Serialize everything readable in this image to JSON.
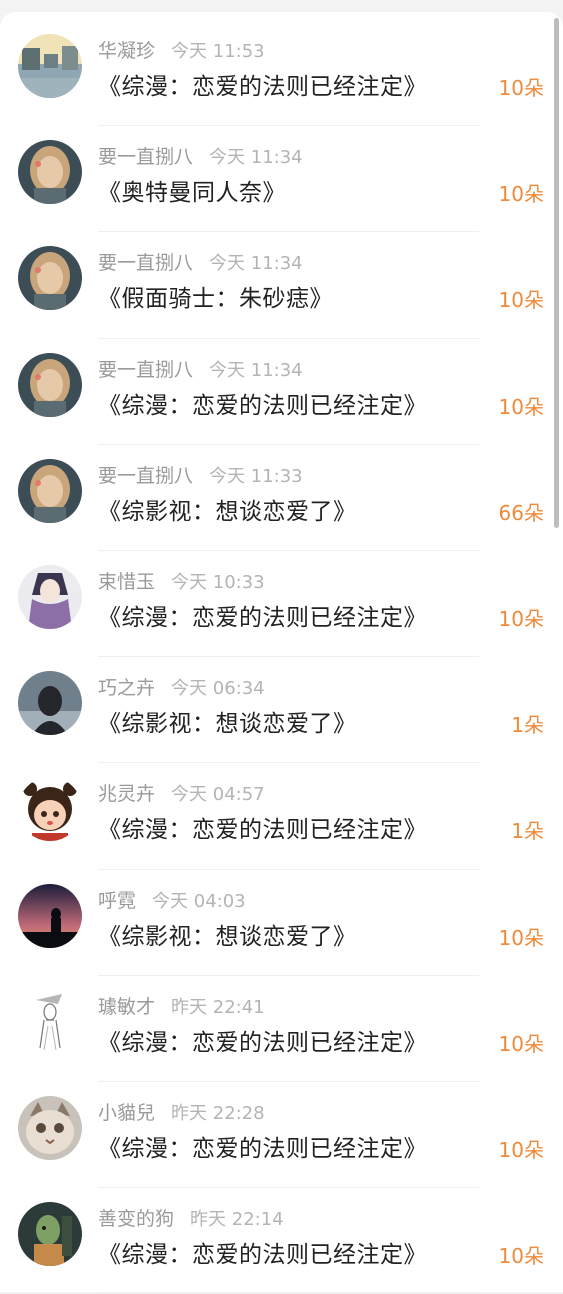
{
  "rows": [
    {
      "user": "华凝珍",
      "time": "今天 11:53",
      "book": "《综漫：恋爱的法则已经注定》",
      "amount": "10朵",
      "avatar": "town-canal-avatar-icon",
      "colors": [
        "#f1e3b8",
        "#8fa7b5",
        "#5e6f72"
      ]
    },
    {
      "user": "要一直捌八",
      "time": "今天 11:34",
      "book": "《奥特曼同人奈》",
      "amount": "10朵",
      "avatar": "anime-girl-avatar-icon",
      "colors": [
        "#3d4d55",
        "#e6c9a8",
        "#c9a57c"
      ]
    },
    {
      "user": "要一直捌八",
      "time": "今天 11:34",
      "book": "《假面骑士：朱砂痣》",
      "amount": "10朵",
      "avatar": "anime-girl-avatar-icon",
      "colors": [
        "#3d4d55",
        "#e6c9a8",
        "#c9a57c"
      ]
    },
    {
      "user": "要一直捌八",
      "time": "今天 11:34",
      "book": "《综漫：恋爱的法则已经注定》",
      "amount": "10朵",
      "avatar": "anime-girl-avatar-icon",
      "colors": [
        "#3d4d55",
        "#e6c9a8",
        "#c9a57c"
      ]
    },
    {
      "user": "要一直捌八",
      "time": "今天 11:33",
      "book": "《综影视：想谈恋爱了》",
      "amount": "66朵",
      "avatar": "anime-girl-avatar-icon",
      "colors": [
        "#3d4d55",
        "#e6c9a8",
        "#c9a57c"
      ]
    },
    {
      "user": "束惜玉",
      "time": "今天 10:33",
      "book": "《综漫：恋爱的法则已经注定》",
      "amount": "10朵",
      "avatar": "purple-scarf-avatar-icon",
      "colors": [
        "#ecebef",
        "#8b6fa6",
        "#3a3650"
      ]
    },
    {
      "user": "巧之卉",
      "time": "今天 06:34",
      "book": "《综影视：想谈恋爱了》",
      "amount": "1朵",
      "avatar": "dark-girl-avatar-icon",
      "colors": [
        "#6f7f8c",
        "#24262c",
        "#c7ced6"
      ]
    },
    {
      "user": "兆灵卉",
      "time": "今天 04:57",
      "book": "《综漫：恋爱的法则已经注定》",
      "amount": "1朵",
      "avatar": "cartoon-girl-avatar-icon",
      "colors": [
        "#ffffff",
        "#3b2418",
        "#f7d2b8"
      ]
    },
    {
      "user": "呼霓",
      "time": "今天 04:03",
      "book": "《综影视：想谈恋爱了》",
      "amount": "10朵",
      "avatar": "sunset-silhouette-avatar-icon",
      "colors": [
        "#1b1d3a",
        "#c06a78",
        "#0b0b12"
      ]
    },
    {
      "user": "璩敏才",
      "time": "昨天 22:41",
      "book": "《综漫：恋爱的法则已经注定》",
      "amount": "10朵",
      "avatar": "sketch-figure-avatar-icon",
      "colors": [
        "#ffffff",
        "#777777",
        "#b5b5b5"
      ]
    },
    {
      "user": "小貓兒",
      "time": "昨天 22:28",
      "book": "《综漫：恋爱的法则已经注定》",
      "amount": "10朵",
      "avatar": "cat-avatar-icon",
      "colors": [
        "#c9c2bb",
        "#e9ded2",
        "#8a7868"
      ]
    },
    {
      "user": "善变的狗",
      "time": "昨天 22:14",
      "book": "《综漫：恋爱的法则已经注定》",
      "amount": "10朵",
      "avatar": "game-character-avatar-icon",
      "colors": [
        "#2c3b3a",
        "#7fa064",
        "#c58a4a"
      ]
    }
  ]
}
